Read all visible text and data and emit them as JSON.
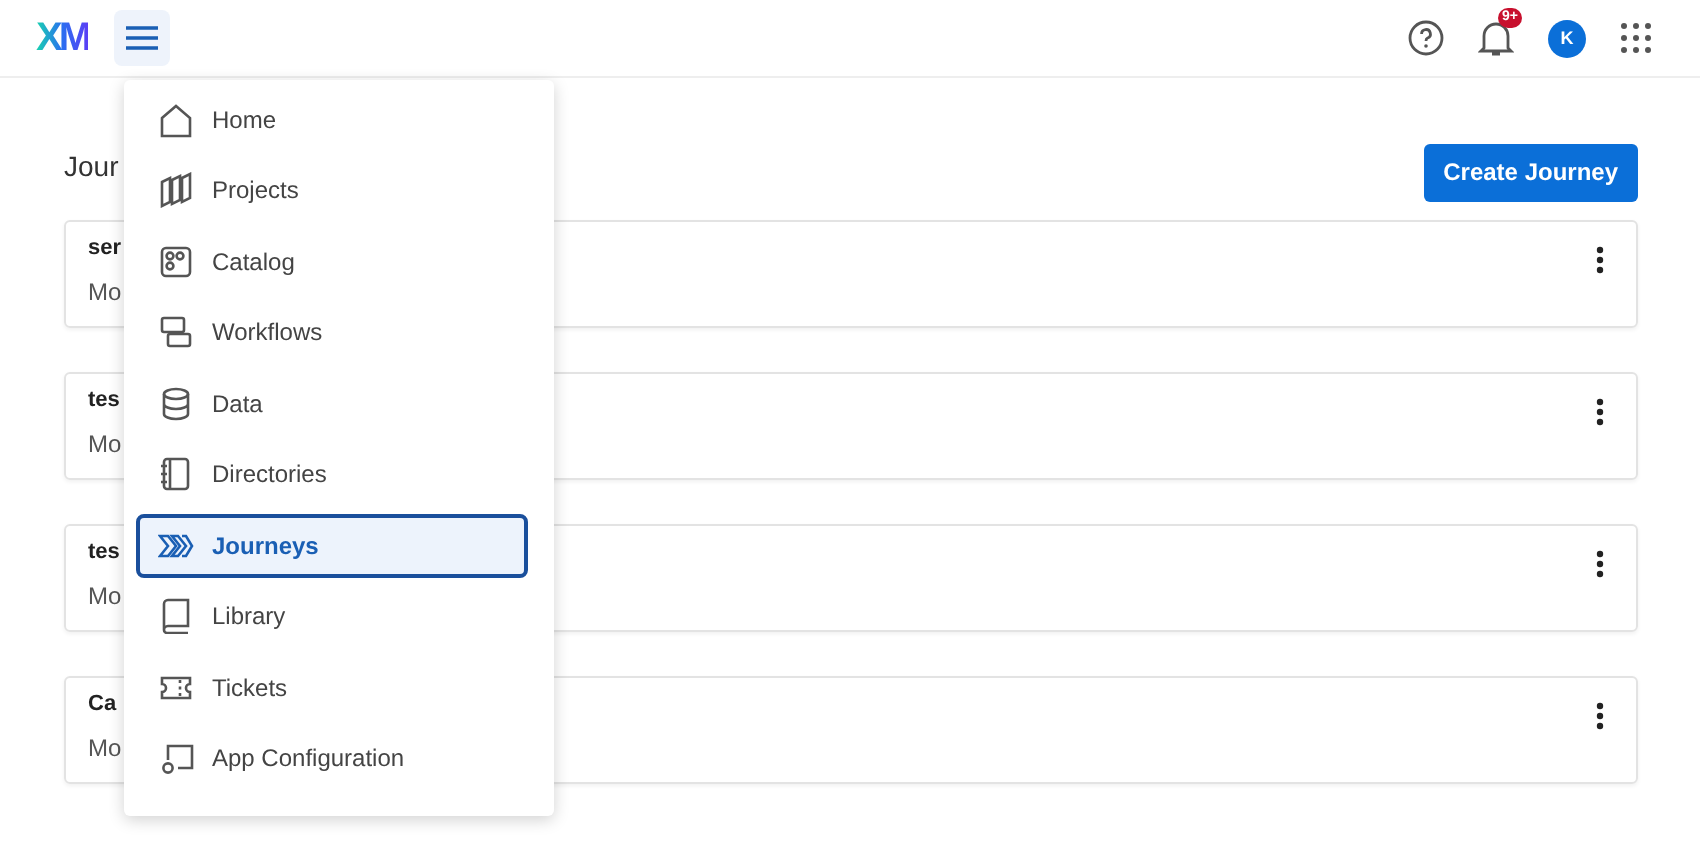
{
  "header": {
    "logo": "XM",
    "notifications_badge": "9+",
    "avatar": "K"
  },
  "page": {
    "heading": "Jour",
    "create_button": "Create Journey",
    "cards": [
      {
        "title": "ser",
        "subtitle": "Mo"
      },
      {
        "title": "tes",
        "subtitle": "Mo"
      },
      {
        "title": "tes",
        "subtitle": "Mo"
      },
      {
        "title": "Ca",
        "subtitle": "Mo"
      }
    ]
  },
  "menu": {
    "items": [
      {
        "label": "Home",
        "selected": false
      },
      {
        "label": "Projects",
        "selected": false
      },
      {
        "label": "Catalog",
        "selected": false
      },
      {
        "label": "Workflows",
        "selected": false
      },
      {
        "label": "Data",
        "selected": false
      },
      {
        "label": "Directories",
        "selected": false
      },
      {
        "label": "Journeys",
        "selected": true
      },
      {
        "label": "Library",
        "selected": false
      },
      {
        "label": "Tickets",
        "selected": false
      },
      {
        "label": "App Configuration",
        "selected": false
      }
    ]
  }
}
